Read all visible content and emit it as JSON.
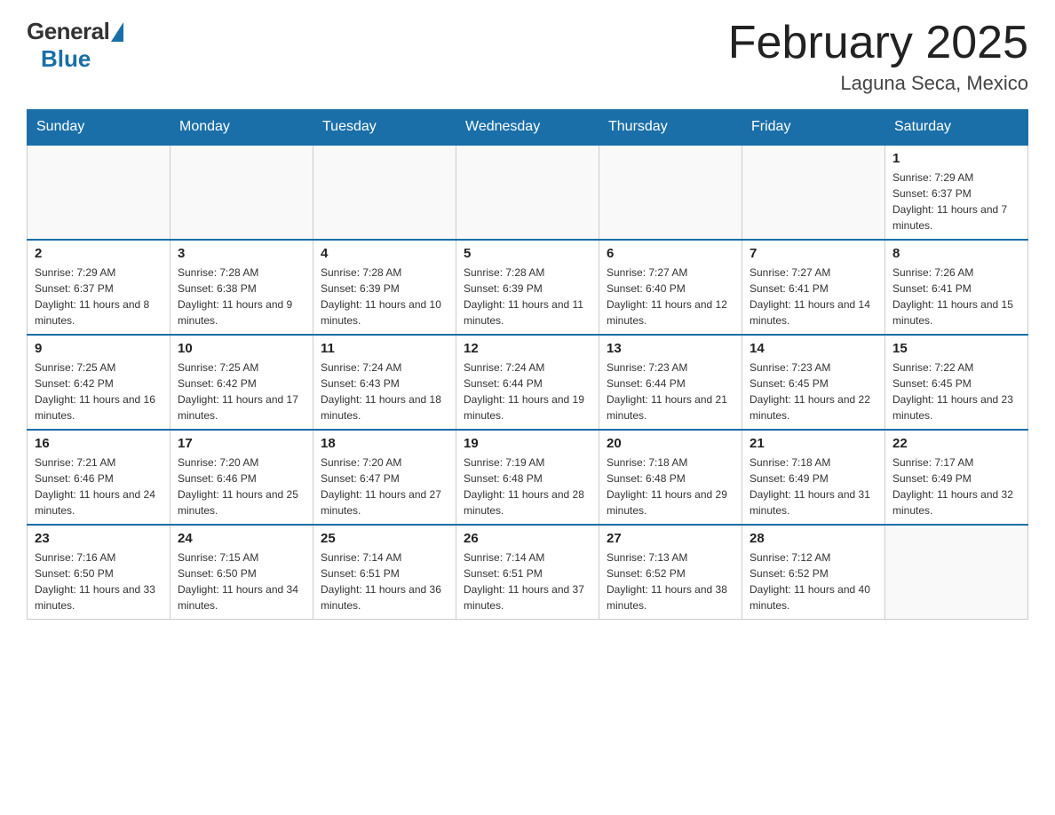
{
  "logo": {
    "general": "General",
    "blue": "Blue"
  },
  "title": "February 2025",
  "subtitle": "Laguna Seca, Mexico",
  "days_of_week": [
    "Sunday",
    "Monday",
    "Tuesday",
    "Wednesday",
    "Thursday",
    "Friday",
    "Saturday"
  ],
  "weeks": [
    [
      {
        "day": "",
        "info": ""
      },
      {
        "day": "",
        "info": ""
      },
      {
        "day": "",
        "info": ""
      },
      {
        "day": "",
        "info": ""
      },
      {
        "day": "",
        "info": ""
      },
      {
        "day": "",
        "info": ""
      },
      {
        "day": "1",
        "info": "Sunrise: 7:29 AM\nSunset: 6:37 PM\nDaylight: 11 hours and 7 minutes."
      }
    ],
    [
      {
        "day": "2",
        "info": "Sunrise: 7:29 AM\nSunset: 6:37 PM\nDaylight: 11 hours and 8 minutes."
      },
      {
        "day": "3",
        "info": "Sunrise: 7:28 AM\nSunset: 6:38 PM\nDaylight: 11 hours and 9 minutes."
      },
      {
        "day": "4",
        "info": "Sunrise: 7:28 AM\nSunset: 6:39 PM\nDaylight: 11 hours and 10 minutes."
      },
      {
        "day": "5",
        "info": "Sunrise: 7:28 AM\nSunset: 6:39 PM\nDaylight: 11 hours and 11 minutes."
      },
      {
        "day": "6",
        "info": "Sunrise: 7:27 AM\nSunset: 6:40 PM\nDaylight: 11 hours and 12 minutes."
      },
      {
        "day": "7",
        "info": "Sunrise: 7:27 AM\nSunset: 6:41 PM\nDaylight: 11 hours and 14 minutes."
      },
      {
        "day": "8",
        "info": "Sunrise: 7:26 AM\nSunset: 6:41 PM\nDaylight: 11 hours and 15 minutes."
      }
    ],
    [
      {
        "day": "9",
        "info": "Sunrise: 7:25 AM\nSunset: 6:42 PM\nDaylight: 11 hours and 16 minutes."
      },
      {
        "day": "10",
        "info": "Sunrise: 7:25 AM\nSunset: 6:42 PM\nDaylight: 11 hours and 17 minutes."
      },
      {
        "day": "11",
        "info": "Sunrise: 7:24 AM\nSunset: 6:43 PM\nDaylight: 11 hours and 18 minutes."
      },
      {
        "day": "12",
        "info": "Sunrise: 7:24 AM\nSunset: 6:44 PM\nDaylight: 11 hours and 19 minutes."
      },
      {
        "day": "13",
        "info": "Sunrise: 7:23 AM\nSunset: 6:44 PM\nDaylight: 11 hours and 21 minutes."
      },
      {
        "day": "14",
        "info": "Sunrise: 7:23 AM\nSunset: 6:45 PM\nDaylight: 11 hours and 22 minutes."
      },
      {
        "day": "15",
        "info": "Sunrise: 7:22 AM\nSunset: 6:45 PM\nDaylight: 11 hours and 23 minutes."
      }
    ],
    [
      {
        "day": "16",
        "info": "Sunrise: 7:21 AM\nSunset: 6:46 PM\nDaylight: 11 hours and 24 minutes."
      },
      {
        "day": "17",
        "info": "Sunrise: 7:20 AM\nSunset: 6:46 PM\nDaylight: 11 hours and 25 minutes."
      },
      {
        "day": "18",
        "info": "Sunrise: 7:20 AM\nSunset: 6:47 PM\nDaylight: 11 hours and 27 minutes."
      },
      {
        "day": "19",
        "info": "Sunrise: 7:19 AM\nSunset: 6:48 PM\nDaylight: 11 hours and 28 minutes."
      },
      {
        "day": "20",
        "info": "Sunrise: 7:18 AM\nSunset: 6:48 PM\nDaylight: 11 hours and 29 minutes."
      },
      {
        "day": "21",
        "info": "Sunrise: 7:18 AM\nSunset: 6:49 PM\nDaylight: 11 hours and 31 minutes."
      },
      {
        "day": "22",
        "info": "Sunrise: 7:17 AM\nSunset: 6:49 PM\nDaylight: 11 hours and 32 minutes."
      }
    ],
    [
      {
        "day": "23",
        "info": "Sunrise: 7:16 AM\nSunset: 6:50 PM\nDaylight: 11 hours and 33 minutes."
      },
      {
        "day": "24",
        "info": "Sunrise: 7:15 AM\nSunset: 6:50 PM\nDaylight: 11 hours and 34 minutes."
      },
      {
        "day": "25",
        "info": "Sunrise: 7:14 AM\nSunset: 6:51 PM\nDaylight: 11 hours and 36 minutes."
      },
      {
        "day": "26",
        "info": "Sunrise: 7:14 AM\nSunset: 6:51 PM\nDaylight: 11 hours and 37 minutes."
      },
      {
        "day": "27",
        "info": "Sunrise: 7:13 AM\nSunset: 6:52 PM\nDaylight: 11 hours and 38 minutes."
      },
      {
        "day": "28",
        "info": "Sunrise: 7:12 AM\nSunset: 6:52 PM\nDaylight: 11 hours and 40 minutes."
      },
      {
        "day": "",
        "info": ""
      }
    ]
  ]
}
